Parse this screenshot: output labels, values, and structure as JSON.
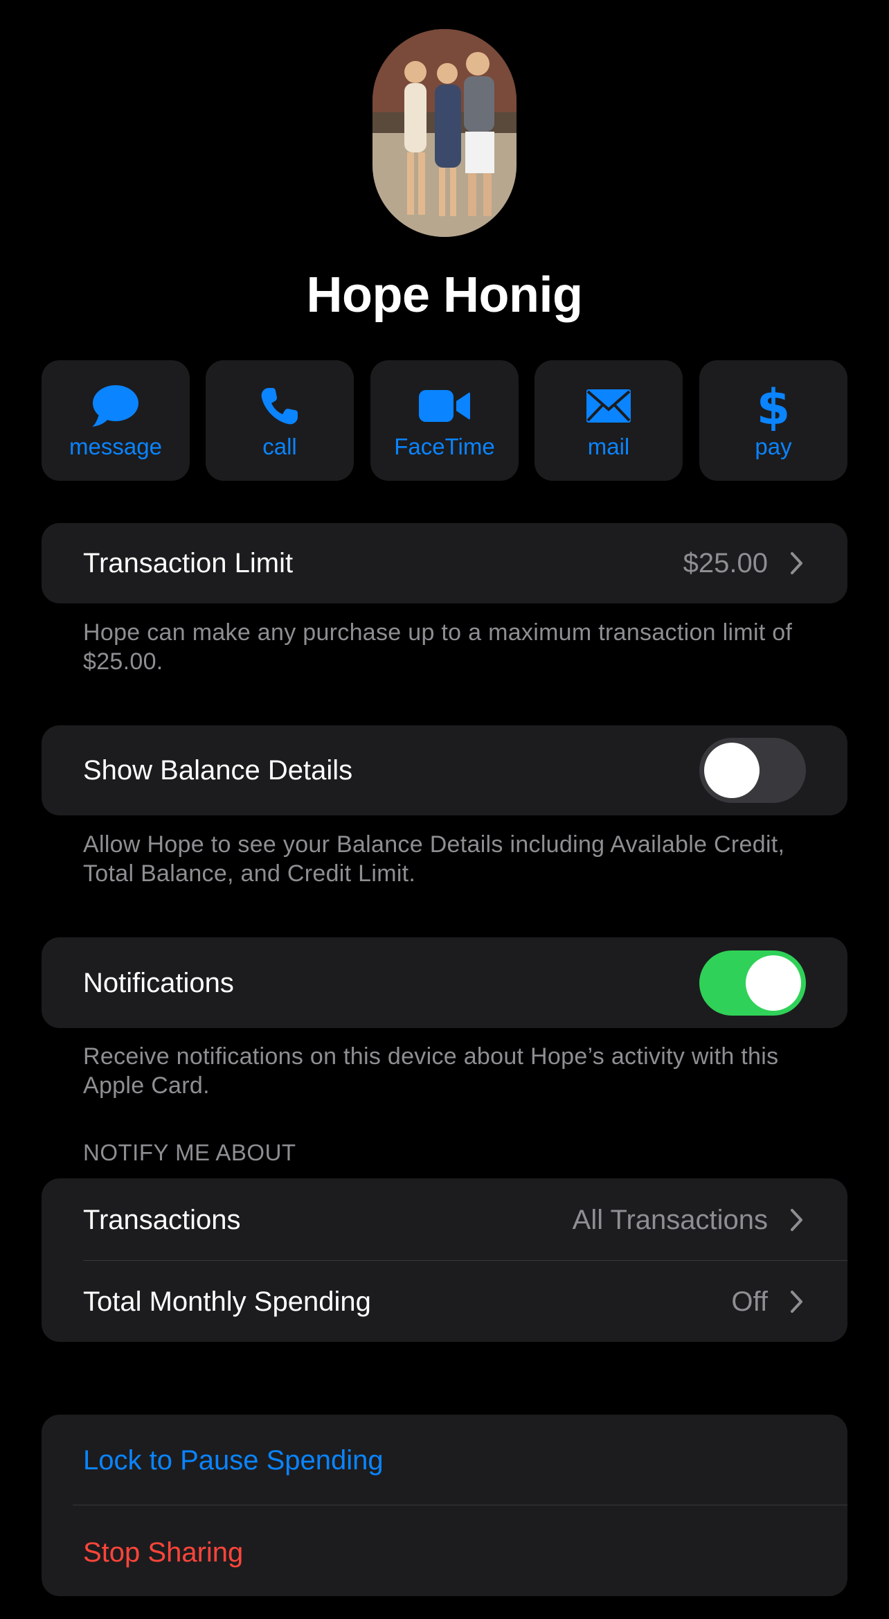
{
  "contact": {
    "name": "Hope Honig"
  },
  "actions": [
    {
      "label": "message",
      "icon": "message-bubble-icon"
    },
    {
      "label": "call",
      "icon": "phone-icon"
    },
    {
      "label": "FaceTime",
      "icon": "video-camera-icon"
    },
    {
      "label": "mail",
      "icon": "envelope-icon"
    },
    {
      "label": "pay",
      "icon": "dollar-icon"
    }
  ],
  "transaction_limit": {
    "label": "Transaction Limit",
    "value": "$25.00",
    "note": "Hope can make any purchase up to a maximum transaction limit of $25.00."
  },
  "balance_details": {
    "label": "Show Balance Details",
    "enabled": false,
    "note": "Allow Hope to see your Balance Details including Available Credit, Total Balance, and Credit Limit."
  },
  "notifications": {
    "label": "Notifications",
    "enabled": true,
    "note": "Receive notifications on this device about Hope’s activity with this Apple Card."
  },
  "notify_about": {
    "header": "NOTIFY ME ABOUT",
    "rows": [
      {
        "label": "Transactions",
        "value": "All Transactions"
      },
      {
        "label": "Total Monthly Spending",
        "value": "Off"
      }
    ]
  },
  "danger": {
    "lock_label": "Lock to Pause Spending",
    "stop_label": "Stop Sharing"
  },
  "colors": {
    "accent": "#0a84ff",
    "destructive": "#ff453a",
    "toggle_on": "#30d158",
    "toggle_off": "#39393d",
    "cell_bg": "#1c1c1e"
  }
}
